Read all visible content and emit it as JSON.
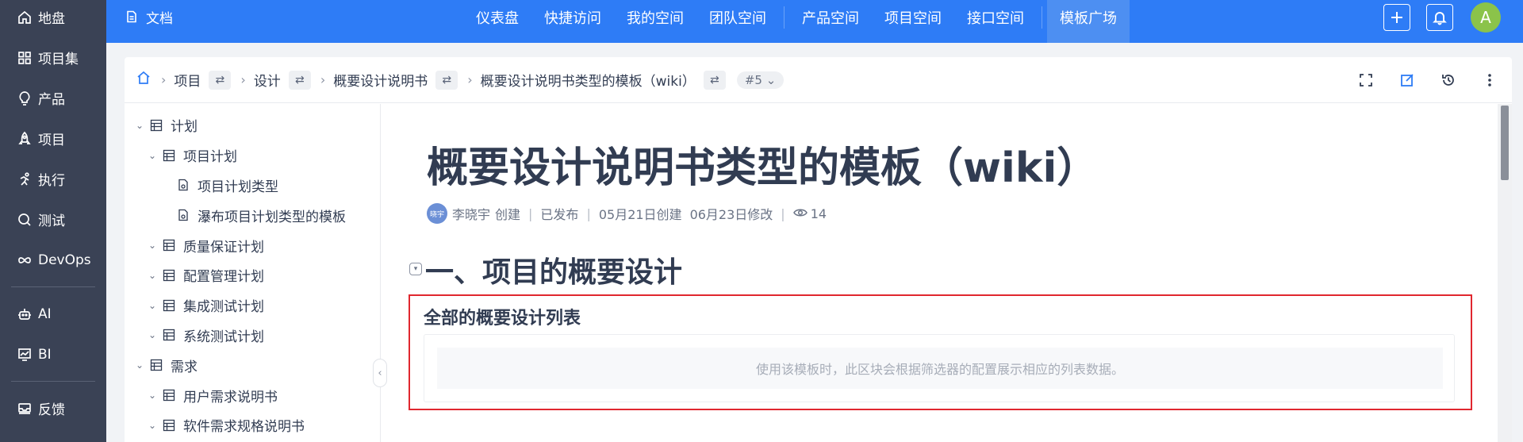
{
  "leftnav": {
    "items": [
      {
        "label": "地盘",
        "icon": "home-icon"
      },
      {
        "label": "项目集",
        "icon": "grid-icon"
      },
      {
        "label": "产品",
        "icon": "bulb-icon"
      },
      {
        "label": "项目",
        "icon": "rocket-icon"
      },
      {
        "label": "执行",
        "icon": "run-icon"
      },
      {
        "label": "测试",
        "icon": "search-icon"
      },
      {
        "label": "DevOps",
        "icon": "infinity-icon"
      },
      {
        "label": "AI",
        "icon": "robot-icon"
      },
      {
        "label": "BI",
        "icon": "chart-icon"
      },
      {
        "label": "反馈",
        "icon": "feedback-icon"
      }
    ]
  },
  "topbar": {
    "doc_label": "文档",
    "nav": [
      "仪表盘",
      "快捷访问",
      "我的空间",
      "团队空间",
      "产品空间",
      "项目空间",
      "接口空间",
      "模板广场"
    ],
    "active": "模板广场",
    "avatar_letter": "A",
    "accent_color": "#2e7cf6"
  },
  "breadcrumb": {
    "items": [
      "项目",
      "设计",
      "概要设计说明书",
      "概要设计说明书类型的模板（wiki）"
    ],
    "version": "#5"
  },
  "tree": [
    {
      "label": "计划",
      "level": 0,
      "icon": "table-icon",
      "chevron": "⌄"
    },
    {
      "label": "项目计划",
      "level": 1,
      "icon": "table-icon",
      "chevron": "⌄"
    },
    {
      "label": "项目计划类型",
      "level": 2,
      "icon": "doc-icon",
      "chevron": ""
    },
    {
      "label": "瀑布项目计划类型的模板",
      "level": 2,
      "icon": "doc-icon",
      "chevron": ""
    },
    {
      "label": "质量保证计划",
      "level": 1,
      "icon": "table-icon",
      "chevron": "⌄"
    },
    {
      "label": "配置管理计划",
      "level": 1,
      "icon": "table-icon",
      "chevron": "⌄"
    },
    {
      "label": "集成测试计划",
      "level": 1,
      "icon": "table-icon",
      "chevron": "⌄"
    },
    {
      "label": "系统测试计划",
      "level": 1,
      "icon": "table-icon",
      "chevron": "⌄"
    },
    {
      "label": "需求",
      "level": 0,
      "icon": "table-icon",
      "chevron": "⌄"
    },
    {
      "label": "用户需求说明书",
      "level": 1,
      "icon": "table-icon",
      "chevron": "⌄"
    },
    {
      "label": "软件需求规格说明书",
      "level": 1,
      "icon": "table-icon",
      "chevron": "⌄"
    }
  ],
  "doc": {
    "title": "概要设计说明书类型的模板（wiki）",
    "author_avatar": "晓宇",
    "author": "李晓宇",
    "created_label": "创建",
    "status": "已发布",
    "created_date": "05月21日创建",
    "modified_date": "06月23日修改",
    "views": "14",
    "section_title": "一、项目的概要设计",
    "block_title": "全部的概要设计列表",
    "block_placeholder": "使用该模板时，此区块会根据筛选器的配置展示相应的列表数据。"
  }
}
